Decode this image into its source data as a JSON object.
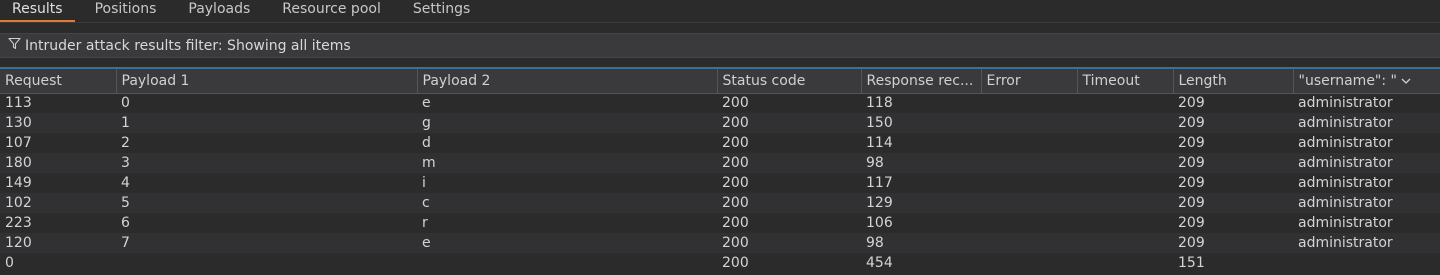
{
  "tabs": [
    {
      "label": "Results"
    },
    {
      "label": "Positions"
    },
    {
      "label": "Payloads"
    },
    {
      "label": "Resource pool"
    },
    {
      "label": "Settings"
    }
  ],
  "filter": {
    "icon": "filter-icon",
    "text": "Intruder attack results filter: Showing all items"
  },
  "table": {
    "columns": [
      "Request",
      "Payload 1",
      "Payload 2",
      "Status code",
      "Response rec...",
      "Error",
      "Timeout",
      "Length",
      "\"username\": \""
    ],
    "sort_icon": "chevron-down-icon",
    "rows": [
      [
        "113",
        "0",
        "e",
        "200",
        "118",
        "",
        "",
        "209",
        "administrator"
      ],
      [
        "130",
        "1",
        "g",
        "200",
        "150",
        "",
        "",
        "209",
        "administrator"
      ],
      [
        "107",
        "2",
        "d",
        "200",
        "114",
        "",
        "",
        "209",
        "administrator"
      ],
      [
        "180",
        "3",
        "m",
        "200",
        "98",
        "",
        "",
        "209",
        "administrator"
      ],
      [
        "149",
        "4",
        "i",
        "200",
        "117",
        "",
        "",
        "209",
        "administrator"
      ],
      [
        "102",
        "5",
        "c",
        "200",
        "129",
        "",
        "",
        "209",
        "administrator"
      ],
      [
        "223",
        "6",
        "r",
        "200",
        "106",
        "",
        "",
        "209",
        "administrator"
      ],
      [
        "120",
        "7",
        "e",
        "200",
        "98",
        "",
        "",
        "209",
        "administrator"
      ],
      [
        "0",
        "",
        "",
        "200",
        "454",
        "",
        "",
        "151",
        ""
      ]
    ]
  },
  "colors": {
    "accent_tab": "#e07b35",
    "table_top_border": "#3c6e9a",
    "background": "#2b2b2b"
  }
}
